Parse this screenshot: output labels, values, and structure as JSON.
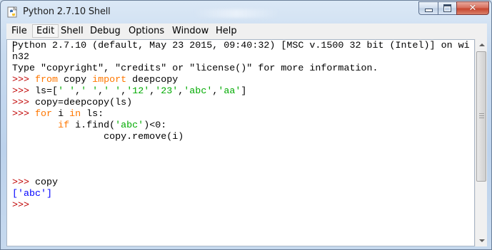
{
  "window": {
    "title": "Python 2.7.10 Shell",
    "icon": "python-idle-icon",
    "controls": {
      "minimize": "minimize-icon",
      "maximize": "maximize-icon",
      "close": "✕"
    }
  },
  "menu": {
    "items": [
      "File",
      "Edit",
      "Shell",
      "Debug",
      "Options",
      "Window",
      "Help"
    ],
    "highlighted": "Edit"
  },
  "colors": {
    "prompt": "#c00000",
    "keyword": "#ff7700",
    "string": "#00aa00",
    "output": "#0000ff",
    "text": "#000000"
  },
  "shell": {
    "lines": [
      [
        {
          "t": "Python 2.7.10 (default, May 23 2015, 09:40:32) [MSC v.1500 32 bit (Intel)] on wi",
          "c": "text"
        }
      ],
      [
        {
          "t": "n32",
          "c": "text"
        }
      ],
      [
        {
          "t": "Type \"copyright\", \"credits\" or \"license()\" for more information.",
          "c": "text"
        }
      ],
      [
        {
          "t": ">>> ",
          "c": "prompt"
        },
        {
          "t": "from",
          "c": "keyword"
        },
        {
          "t": " copy ",
          "c": "text"
        },
        {
          "t": "import",
          "c": "keyword"
        },
        {
          "t": " deepcopy",
          "c": "text"
        }
      ],
      [
        {
          "t": ">>> ",
          "c": "prompt"
        },
        {
          "t": "ls=[",
          "c": "text"
        },
        {
          "t": "' '",
          "c": "string"
        },
        {
          "t": ",",
          "c": "text"
        },
        {
          "t": "' '",
          "c": "string"
        },
        {
          "t": ",",
          "c": "text"
        },
        {
          "t": "' '",
          "c": "string"
        },
        {
          "t": ",",
          "c": "text"
        },
        {
          "t": "'12'",
          "c": "string"
        },
        {
          "t": ",",
          "c": "text"
        },
        {
          "t": "'23'",
          "c": "string"
        },
        {
          "t": ",",
          "c": "text"
        },
        {
          "t": "'abc'",
          "c": "string"
        },
        {
          "t": ",",
          "c": "text"
        },
        {
          "t": "'aa'",
          "c": "string"
        },
        {
          "t": "]",
          "c": "text"
        }
      ],
      [
        {
          "t": ">>> ",
          "c": "prompt"
        },
        {
          "t": "copy=deepcopy(ls)",
          "c": "text"
        }
      ],
      [
        {
          "t": ">>> ",
          "c": "prompt"
        },
        {
          "t": "for",
          "c": "keyword"
        },
        {
          "t": " i ",
          "c": "text"
        },
        {
          "t": "in",
          "c": "keyword"
        },
        {
          "t": " ls:",
          "c": "text"
        }
      ],
      [
        {
          "t": "        ",
          "c": "text"
        },
        {
          "t": "if",
          "c": "keyword"
        },
        {
          "t": " i.find(",
          "c": "text"
        },
        {
          "t": "'abc'",
          "c": "string"
        },
        {
          "t": ")<0:",
          "c": "text"
        }
      ],
      [
        {
          "t": "                copy.remove(i)",
          "c": "text"
        }
      ],
      [
        {
          "t": "",
          "c": "text"
        }
      ],
      [
        {
          "t": "",
          "c": "text"
        }
      ],
      [
        {
          "t": "",
          "c": "text"
        }
      ],
      [
        {
          "t": ">>> ",
          "c": "prompt"
        },
        {
          "t": "copy",
          "c": "text"
        }
      ],
      [
        {
          "t": "['abc']",
          "c": "output"
        }
      ],
      [
        {
          "t": ">>> ",
          "c": "prompt"
        }
      ]
    ]
  }
}
